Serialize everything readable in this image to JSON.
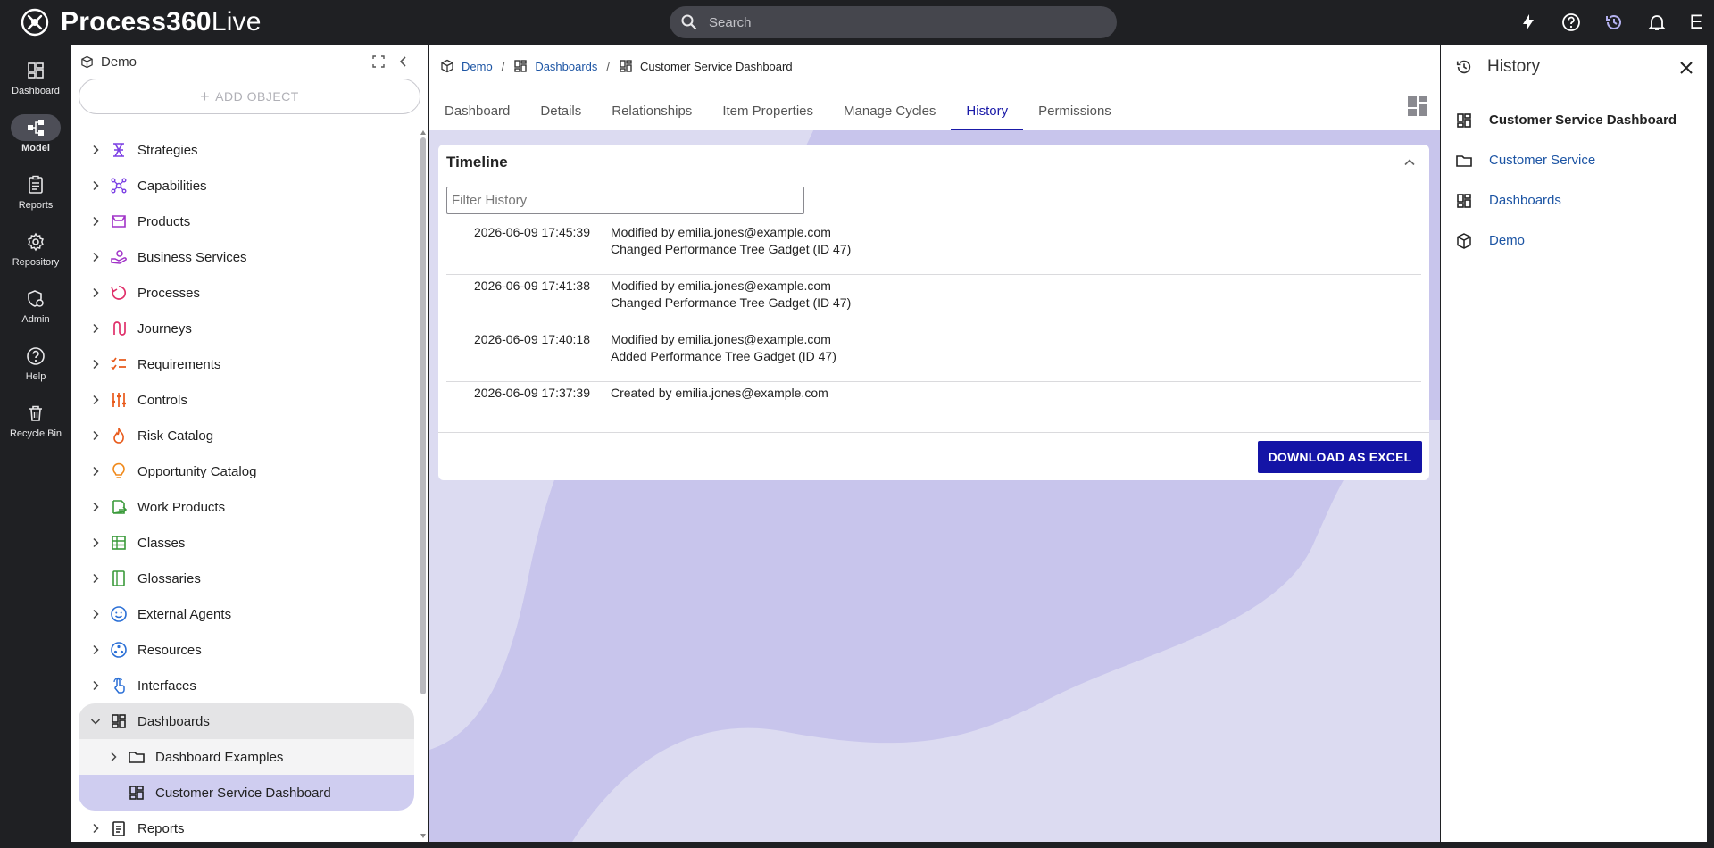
{
  "app": {
    "brand_bold": "Process360",
    "brand_light": "Live"
  },
  "search": {
    "placeholder": "Search"
  },
  "topbar": {
    "avatar_initial": "E"
  },
  "rail": [
    {
      "label": "Dashboard",
      "icon": "dashboard-icon"
    },
    {
      "label": "Model",
      "icon": "model-icon",
      "active": true
    },
    {
      "label": "Reports",
      "icon": "reports-icon"
    },
    {
      "label": "Repository",
      "icon": "gear-icon"
    },
    {
      "label": "Admin",
      "icon": "admin-icon"
    },
    {
      "label": "Help",
      "icon": "help-icon"
    },
    {
      "label": "Recycle Bin",
      "icon": "trash-icon"
    }
  ],
  "tree": {
    "root": "Demo",
    "add_object": "ADD OBJECT",
    "items": [
      {
        "label": "Strategies",
        "icon": "strategies-icon",
        "color": "#7b3fe4"
      },
      {
        "label": "Capabilities",
        "icon": "capabilities-icon",
        "color": "#7b3fe4"
      },
      {
        "label": "Products",
        "icon": "products-icon",
        "color": "#a133c8"
      },
      {
        "label": "Business Services",
        "icon": "business-services-icon",
        "color": "#a133c8"
      },
      {
        "label": "Processes",
        "icon": "processes-icon",
        "color": "#e0306a"
      },
      {
        "label": "Journeys",
        "icon": "journeys-icon",
        "color": "#e0306a"
      },
      {
        "label": "Requirements",
        "icon": "requirements-icon",
        "color": "#e85a1b"
      },
      {
        "label": "Controls",
        "icon": "controls-icon",
        "color": "#e85a1b"
      },
      {
        "label": "Risk Catalog",
        "icon": "risk-icon",
        "color": "#e85a1b"
      },
      {
        "label": "Opportunity Catalog",
        "icon": "opportunity-icon",
        "color": "#f08a1c"
      },
      {
        "label": "Work Products",
        "icon": "work-products-icon",
        "color": "#3a9a3a"
      },
      {
        "label": "Classes",
        "icon": "classes-icon",
        "color": "#3a9a3a"
      },
      {
        "label": "Glossaries",
        "icon": "glossaries-icon",
        "color": "#3a9a3a"
      },
      {
        "label": "External Agents",
        "icon": "external-agents-icon",
        "color": "#2a6fd6"
      },
      {
        "label": "Resources",
        "icon": "resources-icon",
        "color": "#2a6fd6"
      },
      {
        "label": "Interfaces",
        "icon": "interfaces-icon",
        "color": "#2a6fd6"
      }
    ],
    "open_item": "Dashboards",
    "children": [
      "Dashboard Examples",
      "Customer Service Dashboard"
    ],
    "after_item": "Reports"
  },
  "breadcrumb": [
    "Demo",
    "Dashboards",
    "Customer Service Dashboard"
  ],
  "tabs": [
    "Dashboard",
    "Details",
    "Relationships",
    "Item Properties",
    "Manage Cycles",
    "History",
    "Permissions"
  ],
  "active_tab": "History",
  "timeline": {
    "title": "Timeline",
    "filter_placeholder": "Filter History",
    "entries": [
      {
        "date": "2026-06-09 17:45:39",
        "line1": "Modified by emilia.jones@example.com",
        "line2": "Changed Performance Tree Gadget (ID 47)"
      },
      {
        "date": "2026-06-09 17:41:38",
        "line1": "Modified by emilia.jones@example.com",
        "line2": "Changed Performance Tree Gadget (ID 47)"
      },
      {
        "date": "2026-06-09 17:40:18",
        "line1": "Modified by emilia.jones@example.com",
        "line2": "Added Performance Tree Gadget (ID 47)"
      },
      {
        "date": "2026-06-09 17:37:39",
        "line1": "Created by emilia.jones@example.com",
        "line2": ""
      }
    ],
    "download_label": "DOWNLOAD AS EXCEL"
  },
  "history_panel": {
    "title": "History",
    "items": [
      "Customer Service Dashboard",
      "Customer Service",
      "Dashboards",
      "Demo"
    ]
  },
  "colors": {
    "accent": "#1a1aa8",
    "link": "#1d55a4",
    "selected": "#cfcdf0",
    "bg": "#dcdbf1"
  }
}
